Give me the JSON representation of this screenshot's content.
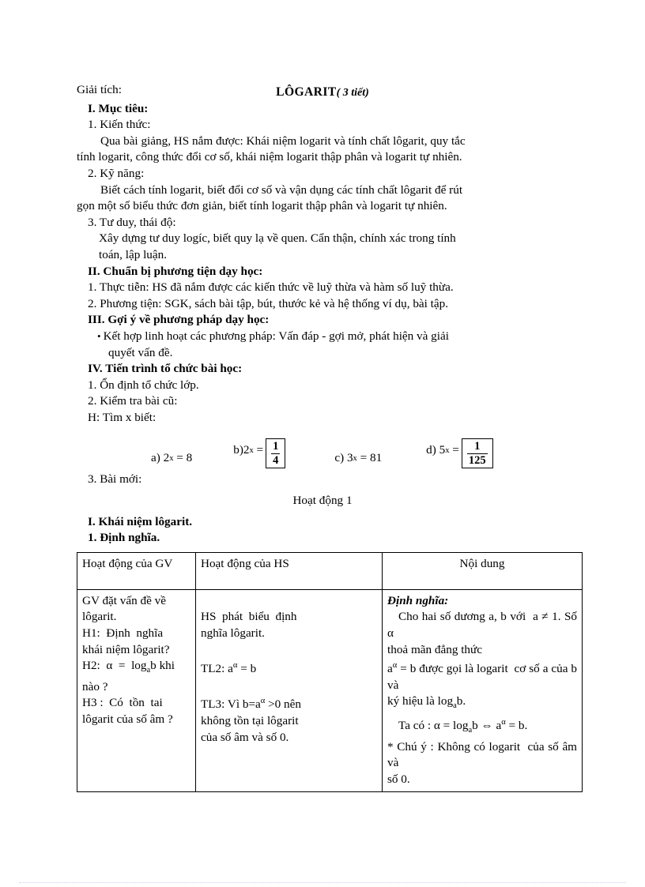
{
  "document": {
    "subject_label": "Giải tích:",
    "title": "LÔGARIT",
    "title_note": "( 3 tiết)"
  },
  "sections": {
    "objectives": {
      "heading": "I. Mục tiêu:",
      "sub1_heading": "1. Kiến thức:",
      "sub1_body_line1": "Qua bài giảng, HS nắm được: Khái niệm logarit và tính chất lôgarit, quy tắc",
      "sub1_body_line2": "tính logarit, công thức đổi cơ số, khái niệm logarit thập phân và logarit tự nhiên.",
      "sub2_heading": "2. Kỹ năng:",
      "sub2_body_line1": "Biết cách tính logarit, biết đổi cơ số và vận dụng các tính chất lôgarit để rút",
      "sub2_body_line2": "gọn một số biểu thức đơn giản, biết tính logarit thập phân và logarit tự nhiên.",
      "sub3_heading": "3. Tư duy, thái độ:",
      "sub3_body_line1": "Xây dựng tư duy logíc, biết quy lạ về quen. Cẩn thận, chính xác trong tính",
      "sub3_body_line2": "toán, lập luận."
    },
    "preparation": {
      "heading": "II. Chuẩn bị phương tiện dạy học:",
      "item1": "1. Thực tiễn: HS đã nắm được các kiến thức về luỹ thừa và hàm số luỹ thừa.",
      "item2": "2. Phương tiện: SGK, sách bài tập, bút, thước kẻ và hệ thống ví dụ, bài tập."
    },
    "methods": {
      "heading": "III. Gợi ý về phương pháp dạy học:",
      "bullet_marker": "•",
      "bullet_line1": "Kết hợp linh hoạt các phương pháp: Vấn đáp - gợi mở, phát hiện và giải",
      "bullet_line2": "quyết vấn đề."
    },
    "procedure": {
      "heading": "IV. Tiến trình tổ chức bài học:",
      "item1": "1. Ổn định tổ chức lớp.",
      "item2": "2. Kiểm tra bài cũ:",
      "question_prompt": "H: Tìm x biết:",
      "item3": "3. Bài mới:",
      "activity_label": "Hoạt động 1",
      "concept_heading": "I. Khái niệm lôgarit.",
      "definition_heading": "1. Định nghĩa."
    }
  },
  "equations": [
    {
      "label": "a)",
      "base": "2",
      "exponent": "x",
      "equals": "=",
      "value": "8",
      "boxed": false
    },
    {
      "label": "b)",
      "base": "2",
      "exponent": "x",
      "equals": "=",
      "numerator": "1",
      "denominator": "4",
      "boxed": true
    },
    {
      "label": "c)",
      "base": "3",
      "exponent": "x",
      "equals": "=",
      "value": "81",
      "boxed": false
    },
    {
      "label": "d)",
      "base": "5",
      "exponent": "x",
      "equals": "=",
      "numerator": "1",
      "denominator": "125",
      "boxed": true
    }
  ],
  "table": {
    "headers": {
      "col1": "Hoạt động của GV",
      "col2": "Hoạt động của HS",
      "col3": "Nội dung"
    },
    "col1_lines": [
      "GV đặt vấn đề về",
      "lôgarit.",
      "H1:  Định  nghĩa",
      "khái niệm lôgarit?",
      "H2:  α  =  log",
      "nào ?",
      "H3 :  Có  tồn  tai",
      "lôgarit của số âm ?"
    ],
    "col1_h2_prefix": "H2:  α  =  log",
    "col1_h2_sub": "a",
    "col1_h2_suffix": "b khi",
    "col1_h2_next": "nào ?",
    "col2_lines": {
      "l1": "HS  phát  biểu  định",
      "l2": "nghĩa lôgarit.",
      "l3_prefix": "TL2: a",
      "l3_sup": "α",
      "l3_suffix": " = b",
      "l4_prefix": "TL3: Vì b=a",
      "l4_sup": "α",
      "l4_suffix": " >0 nên",
      "l5": "không tồn tại lôgarit",
      "l6": "của số âm và số 0."
    },
    "col3": {
      "def_heading": "Định nghĩa:",
      "l1": "Cho hai số dương a, b với  a ≠ 1. Số α",
      "l2": "thoả mãn đẳng thức",
      "l3_prefix": "a",
      "l3_sup": "α",
      "l3_mid": " = b được gọi là logarit  cơ số a của b và",
      "l4_prefix": "ký hiệu là log",
      "l4_sub": "a",
      "l4_suffix": "b.",
      "l5_prefix": "Ta có : α = log",
      "l5_sub": "a",
      "l5_mid": "b ⇔ a",
      "l5_sup": "α",
      "l5_suffix": " = b.",
      "l6": "* Chú ý : Không có logarit  của số âm và",
      "l7": "số 0."
    }
  }
}
